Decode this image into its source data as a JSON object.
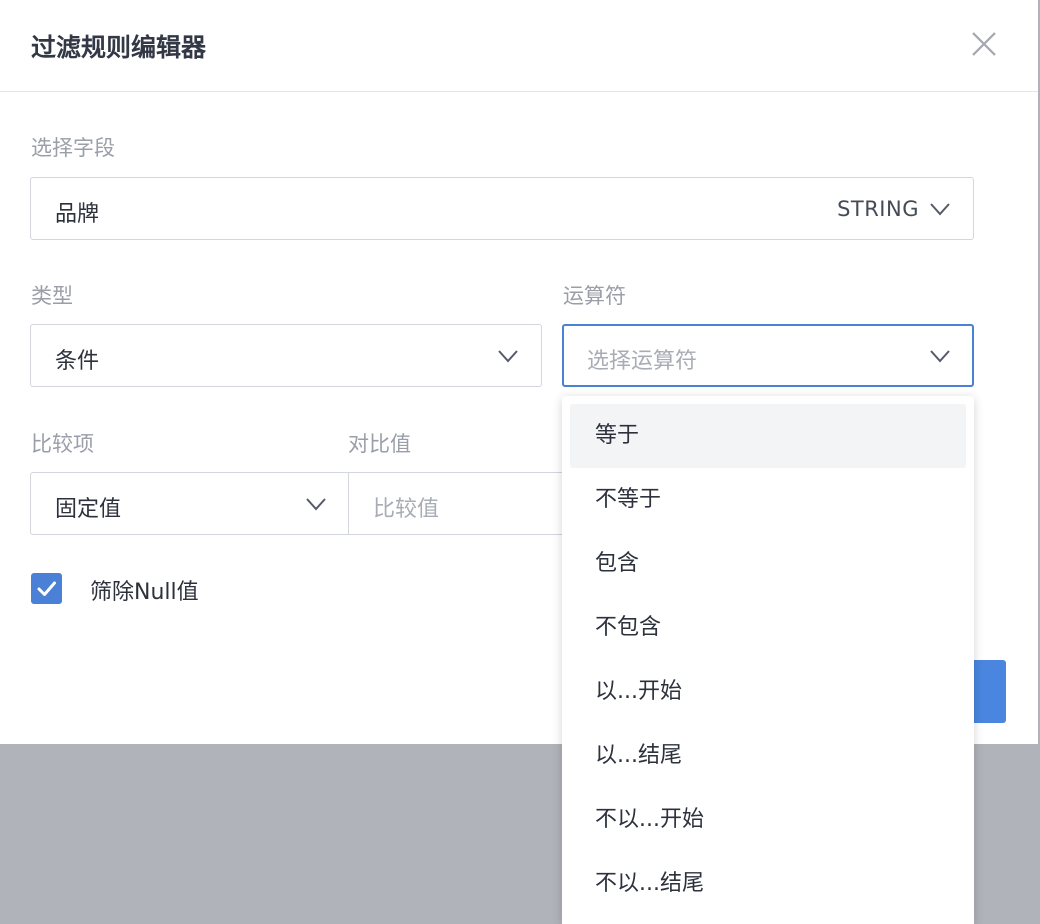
{
  "dialog": {
    "title": "过滤规则编辑器"
  },
  "field_section": {
    "label": "选择字段",
    "value": "品牌",
    "type_tag": "STRING"
  },
  "type_section": {
    "label": "类型",
    "value": "条件"
  },
  "operator_section": {
    "label": "运算符",
    "placeholder": "选择运算符",
    "options": [
      "等于",
      "不等于",
      "包含",
      "不包含",
      "以...开始",
      "以...结尾",
      "不以...开始",
      "不以...结尾"
    ],
    "hovered_index": 0
  },
  "compare_item": {
    "label": "比较项",
    "value": "固定值"
  },
  "compare_value": {
    "label": "对比值",
    "placeholder": "比较值"
  },
  "filter_null": {
    "label": "筛除Null值",
    "checked": true
  },
  "colors": {
    "accent": "#4a80d6",
    "overlay": "#b0b3ba"
  },
  "icons": {
    "close": "close-icon",
    "dropdown": "chevron-down-icon",
    "check": "check-icon"
  }
}
